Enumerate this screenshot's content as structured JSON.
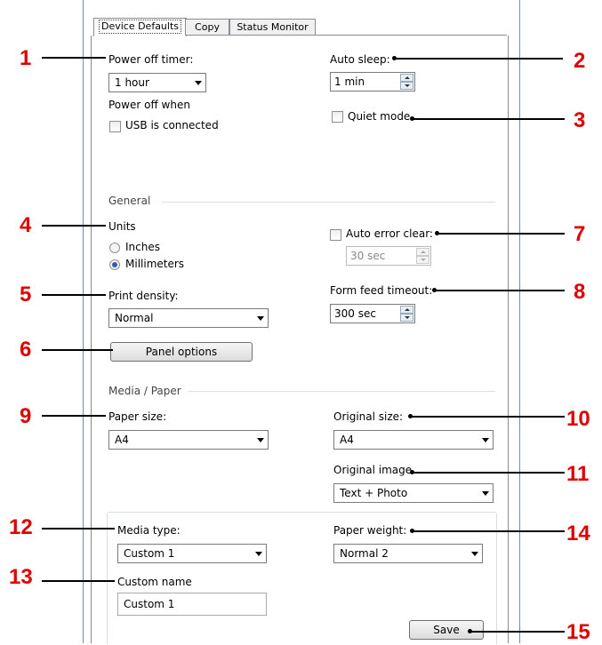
{
  "tabs": [
    "Device Defaults",
    "Copy",
    "Status Monitor"
  ],
  "power_off_timer": {
    "label": "Power off timer:",
    "value": "1 hour"
  },
  "power_off_when": {
    "label": "Power off when",
    "usb_label": "USB is connected"
  },
  "auto_sleep": {
    "label": "Auto sleep:",
    "value": "1 min"
  },
  "quiet_mode": {
    "label": "Quiet mode"
  },
  "general": {
    "label": "General"
  },
  "units": {
    "label": "Units",
    "inches": "Inches",
    "millimeters": "Millimeters"
  },
  "auto_error_clear": {
    "label": "Auto error clear:",
    "value": "30 sec"
  },
  "print_density": {
    "label": "Print density:",
    "value": "Normal"
  },
  "form_feed_timeout": {
    "label": "Form feed timeout:",
    "value": "300 sec"
  },
  "panel_options": {
    "label": "Panel options"
  },
  "media_paper": {
    "label": "Media / Paper"
  },
  "paper_size": {
    "label": "Paper size:",
    "value": "A4"
  },
  "original_size": {
    "label": "Original size:",
    "value": "A4"
  },
  "original_image": {
    "label": "Original image",
    "value": "Text + Photo"
  },
  "media_type": {
    "label": "Media type:",
    "value": "Custom 1"
  },
  "paper_weight": {
    "label": "Paper weight:",
    "value": "Normal 2"
  },
  "custom_name": {
    "label": "Custom name",
    "value": "Custom 1"
  },
  "save": {
    "label": "Save"
  },
  "callouts": [
    "1",
    "2",
    "3",
    "4",
    "5",
    "6",
    "7",
    "8",
    "9",
    "10",
    "11",
    "12",
    "13",
    "14",
    "15"
  ],
  "colors": {
    "callout": "#e00000",
    "accent": "#2d5fb4"
  }
}
